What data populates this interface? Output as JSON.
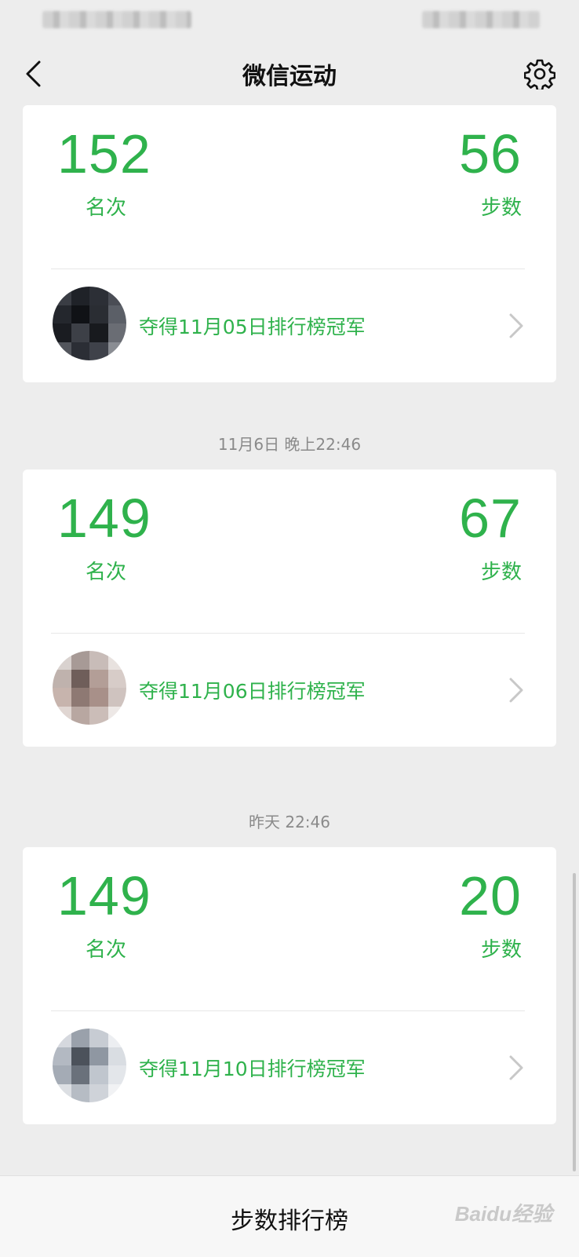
{
  "header": {
    "title": "微信运动",
    "back_icon": "back-arrow-icon",
    "settings_icon": "gear-icon"
  },
  "accent_color": "#2fb24c",
  "entries": [
    {
      "timestamp": "",
      "rank": "152",
      "rank_label": "名次",
      "steps": "56",
      "steps_label": "步数",
      "champion_text": "夺得11月05日排行榜冠军"
    },
    {
      "timestamp": "11月6日 晚上22:46",
      "rank": "149",
      "rank_label": "名次",
      "steps": "67",
      "steps_label": "步数",
      "champion_text": "夺得11月06日排行榜冠军"
    },
    {
      "timestamp": "昨天 22:46",
      "rank": "149",
      "rank_label": "名次",
      "steps": "20",
      "steps_label": "步数",
      "champion_text": "夺得11月10日排行榜冠军"
    }
  ],
  "footer": {
    "label": "步数排行榜",
    "watermark": "Baidu经验"
  }
}
